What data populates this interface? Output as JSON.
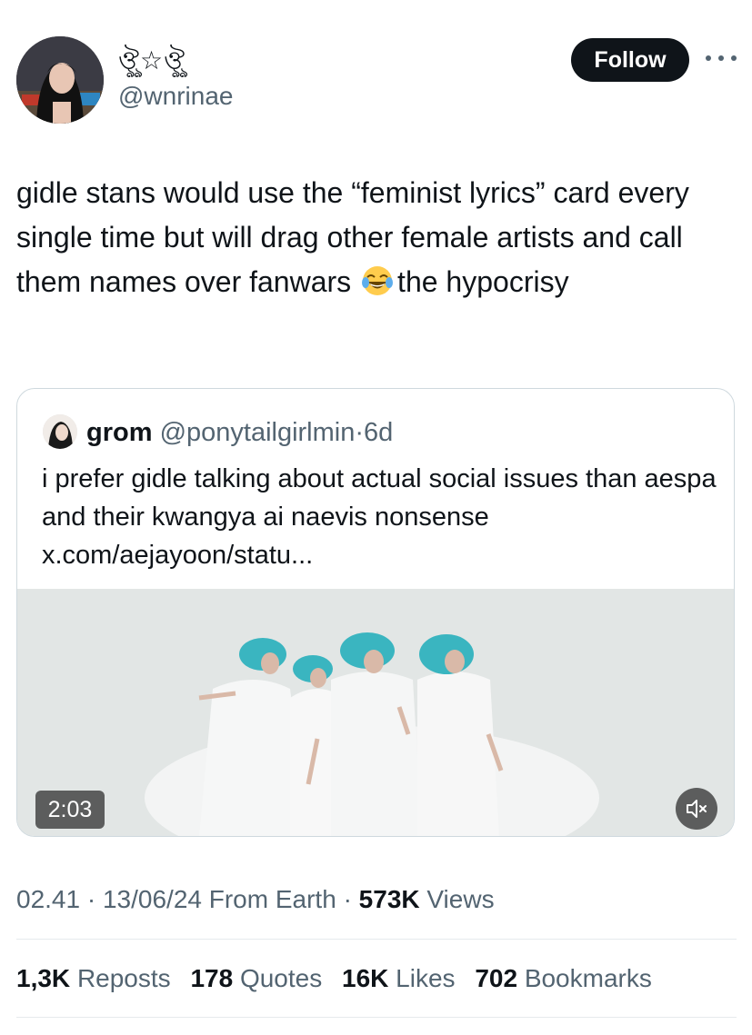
{
  "author": {
    "display_name": "ঔৣ☆ঔৣ",
    "handle": "@wnrinae",
    "avatar_icon": "profile-photo"
  },
  "follow_label": "Follow",
  "more_icon": "more-horizontal-icon",
  "tweet": {
    "text_before_emoji": "gidle stans would use the “feminist lyrics” card every single time but will drag other female artists and call them names over fanwars",
    "emoji": "face-with-tears-of-joy",
    "text_after_emoji": "the hypocrisy"
  },
  "quote": {
    "name": "grom",
    "handle": "@ponytailgirlmin",
    "separator": "·",
    "age": "6d",
    "text": "i prefer gidle talking about actual social issues than aespa and their kwangya ai naevis nonsense",
    "link": "x.com/aejayoon/statu...",
    "video_duration": "2:03",
    "mute_icon": "speaker-muted-icon"
  },
  "meta": {
    "time": "02.41",
    "sep1": "·",
    "date": "13/06/24",
    "location": "From Earth",
    "sep2": "·",
    "views_count": "573K",
    "views_label": "Views"
  },
  "stats": [
    {
      "count": "1,3K",
      "label": "Reposts"
    },
    {
      "count": "178",
      "label": "Quotes"
    },
    {
      "count": "16K",
      "label": "Likes"
    },
    {
      "count": "702",
      "label": "Bookmarks"
    }
  ],
  "colors": {
    "text": "#0f1419",
    "secondary": "#536471",
    "border": "#cfd9de",
    "button_bg": "#0f1419",
    "hat_teal": "#3ab5c0"
  }
}
